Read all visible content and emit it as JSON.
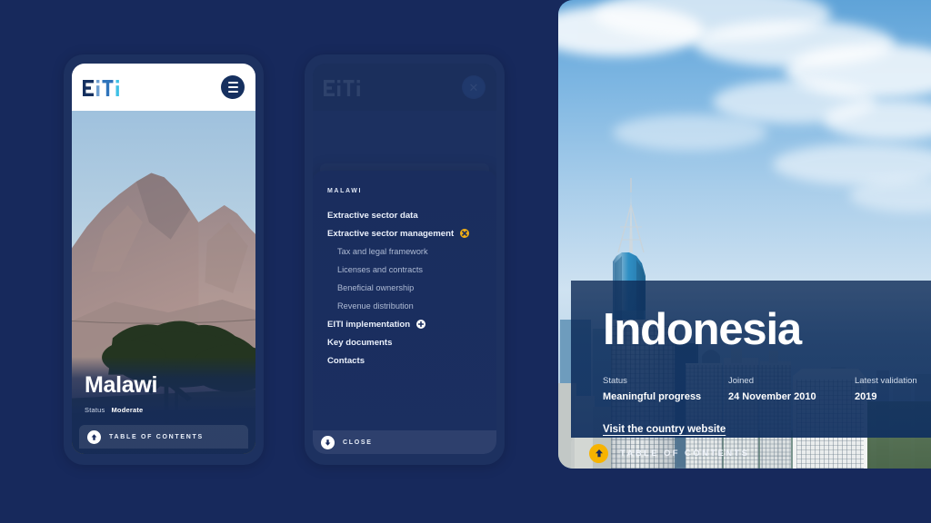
{
  "theme": {
    "page_background": "#17295c",
    "panel_navy": "#1a2d5e",
    "accent_gold": "#f6b300",
    "text_white": "#ffffff"
  },
  "brand": {
    "logo_text": "EITI",
    "logo_name": "eiti-logo",
    "logo_colors": [
      "#15305f",
      "#6f9fd0",
      "#2f74bb",
      "#3fc1e6"
    ]
  },
  "phone_malawi": {
    "menu_icon": "hamburger-icon",
    "photo_alt": "Mount Mulanje massif with acacia tree, Malawi",
    "country": "Malawi",
    "status_label": "Status",
    "status_value": "Moderate",
    "toc": {
      "icon": "arrow-up-circle-icon",
      "label": "TABLE OF CONTENTS"
    }
  },
  "phone_menu": {
    "close_icon": "close-circle-icon",
    "country_heading": "MALAWI",
    "items": [
      {
        "label": "Extractive sector data",
        "level": 1,
        "toggle": null
      },
      {
        "label": "Extractive sector management",
        "level": 1,
        "toggle": "minus-circle-icon"
      },
      {
        "label": "Tax and legal framework",
        "level": 2,
        "toggle": null
      },
      {
        "label": "Licenses and contracts",
        "level": 2,
        "toggle": null
      },
      {
        "label": "Beneficial ownership",
        "level": 2,
        "toggle": null
      },
      {
        "label": "Revenue distribution",
        "level": 2,
        "toggle": null
      },
      {
        "label": "EITI implementation",
        "level": 1,
        "toggle": "plus-circle-icon"
      },
      {
        "label": "Key documents",
        "level": 1,
        "toggle": null
      },
      {
        "label": "Contacts",
        "level": 1,
        "toggle": null
      }
    ],
    "close": {
      "icon": "arrow-down-circle-icon",
      "label": "CLOSE"
    }
  },
  "panel_indonesia": {
    "photo_alt": "Jakarta skyline with high-rise towers and blue cloudy sky",
    "country": "Indonesia",
    "meta": [
      {
        "label": "Status",
        "value": "Meaningful progress"
      },
      {
        "label": "Joined",
        "value": "24 November 2010"
      },
      {
        "label": "Latest validation",
        "value": "2019"
      }
    ],
    "link_label": "Visit the country website",
    "toc": {
      "icon": "arrow-up-circle-icon",
      "label": "TABLE OF CONTENTS"
    }
  }
}
